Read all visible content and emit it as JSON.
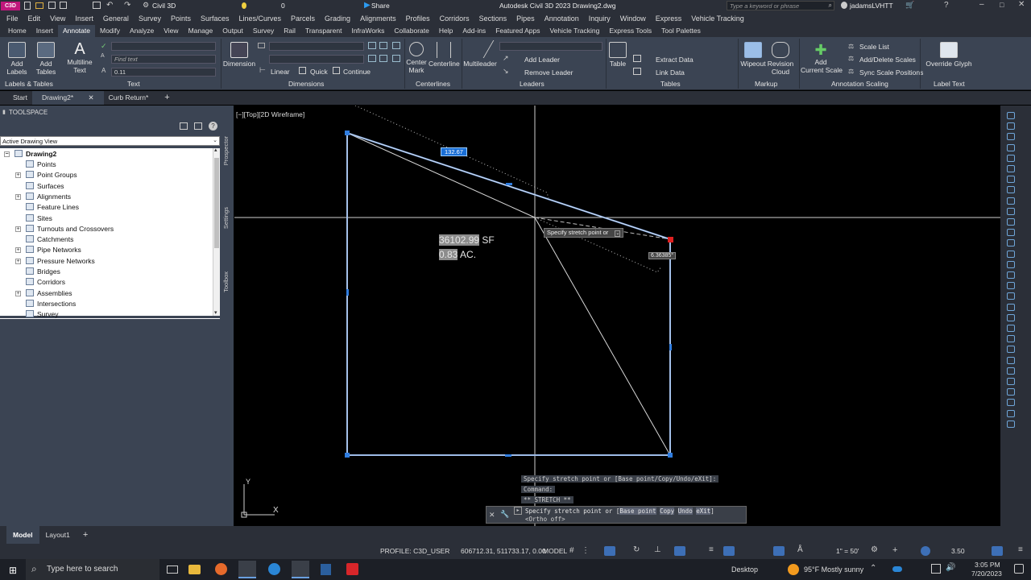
{
  "titlebar": {
    "app_badge": "C3D",
    "workspace": "Civil 3D",
    "layer": "0",
    "share": "Share",
    "title": "Autodesk Civil 3D 2023   Drawing2.dwg",
    "search_placeholder": "Type a keyword or phrase",
    "user": "jadamsLVHTT"
  },
  "menubar": [
    "File",
    "Edit",
    "View",
    "Insert",
    "General",
    "Survey",
    "Points",
    "Surfaces",
    "Lines/Curves",
    "Parcels",
    "Grading",
    "Alignments",
    "Profiles",
    "Corridors",
    "Sections",
    "Pipes",
    "Annotation",
    "Inquiry",
    "Window",
    "Express",
    "Vehicle Tracking"
  ],
  "ribbon_tabs": [
    "Home",
    "Insert",
    "Annotate",
    "Modify",
    "Analyze",
    "View",
    "Manage",
    "Output",
    "Survey",
    "Rail",
    "Transparent",
    "InfraWorks",
    "Collaborate",
    "Help",
    "Add-ins",
    "Featured Apps",
    "Vehicle Tracking",
    "Express Tools",
    "Tool Palettes"
  ],
  "active_ribbon_tab": "Annotate",
  "ribbon": {
    "add_labels": "Add\nLabels",
    "add_tables": "Add\nTables",
    "multiline_text": "Multiline\nText",
    "find_text_placeholder": "Find text",
    "text_height": "0.11",
    "dimension": "Dimension",
    "linear": "Linear",
    "quick": "Quick",
    "continue": "Continue",
    "center_mark": "Center\nMark",
    "centerline": "Centerline",
    "multileader": "Multileader",
    "add_leader": "Add Leader",
    "remove_leader": "Remove Leader",
    "table": "Table",
    "extract_data": "Extract Data",
    "link_data": "Link Data",
    "wipeout": "Wipeout",
    "revision_cloud": "Revision\nCloud",
    "add_current_scale": "Add\nCurrent Scale",
    "scale_list": "Scale List",
    "add_delete_scales": "Add/Delete Scales",
    "sync_scale_positions": "Sync Scale Positions",
    "override_glyph": "Override Glyph",
    "panels": [
      "Labels & Tables",
      "Text",
      "Dimensions",
      "Centerlines",
      "Leaders",
      "Tables",
      "Markup",
      "Annotation Scaling",
      "Label Text"
    ]
  },
  "doc_tabs": [
    "Start",
    "Drawing2*",
    "Curb Return*"
  ],
  "toolspace": {
    "title": "TOOLSPACE",
    "view_select": "Active Drawing View",
    "side_tabs": [
      "Prospector",
      "Settings",
      "Toolbox"
    ],
    "root": "Drawing2",
    "items": [
      {
        "label": "Points",
        "expand": false
      },
      {
        "label": "Point Groups",
        "expand": true
      },
      {
        "label": "Surfaces",
        "expand": false
      },
      {
        "label": "Alignments",
        "expand": true
      },
      {
        "label": "Feature Lines",
        "expand": false
      },
      {
        "label": "Sites",
        "expand": false
      },
      {
        "label": "Turnouts and Crossovers",
        "expand": true
      },
      {
        "label": "Catchments",
        "expand": false
      },
      {
        "label": "Pipe Networks",
        "expand": true
      },
      {
        "label": "Pressure Networks",
        "expand": true
      },
      {
        "label": "Bridges",
        "expand": false
      },
      {
        "label": "Corridors",
        "expand": false
      },
      {
        "label": "Assemblies",
        "expand": true
      },
      {
        "label": "Intersections",
        "expand": false
      },
      {
        "label": "Survey",
        "expand": false
      }
    ]
  },
  "canvas": {
    "viewport_label": "[−][Top][2D Wireframe]",
    "dim_value": "132.67",
    "area_sf_value": "36102.99",
    "area_sf_unit": "SF",
    "area_ac_value": "0.83",
    "area_ac_unit": "AC.",
    "tooltip": "Specify stretch point or",
    "angle": "6.36385°",
    "ucs_y": "Y",
    "ucs_x": "X"
  },
  "command": {
    "history": [
      "Specify stretch point or [Base point/Copy/Undo/eXit]:",
      "Command:",
      "** STRETCH **"
    ],
    "prompt_prefix": "Specify stretch point or [",
    "options": [
      "Base point",
      "Copy",
      "Undo",
      "eXit"
    ],
    "prompt_suffix": "]",
    "ortho": "<Ortho off>"
  },
  "layout_tabs": [
    "Model",
    "Layout1"
  ],
  "status": {
    "profile": "PROFILE: C3D_USER",
    "coords": "606712.31, 511733.17, 0.00",
    "model": "MODEL",
    "scale": "1\" = 50'",
    "value": "3.50"
  },
  "taskbar": {
    "search_placeholder": "Type here to search",
    "desktop": "Desktop",
    "weather": "95°F  Mostly sunny",
    "time": "3:05 PM",
    "date": "7/20/2023"
  },
  "colors": {
    "ribbon_bg": "#3b4453",
    "chrome_bg": "#2b2f38",
    "selection_blue": "#7ea6e0",
    "grip_red": "#e02020",
    "app_badge": "#c0177c"
  }
}
